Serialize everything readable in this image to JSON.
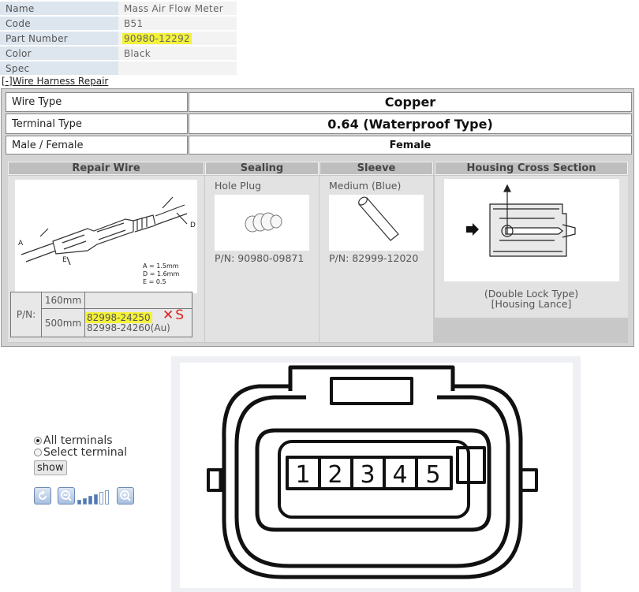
{
  "info": [
    {
      "key": "Name",
      "value": "Mass Air Flow Meter"
    },
    {
      "key": "Code",
      "value": "B51"
    },
    {
      "key": "Part Number",
      "value": "90980-12292"
    },
    {
      "key": "Color",
      "value": "Black"
    },
    {
      "key": "Spec",
      "value": ""
    }
  ],
  "harness": {
    "toggle_prefix": "[-]",
    "toggle_label": "Wire Harness Repair",
    "rows": [
      {
        "key": "Wire Type",
        "value": "Copper"
      },
      {
        "key": "Terminal Type",
        "value": "0.64 (Waterproof Type)"
      },
      {
        "key": "Male / Female",
        "value": "Female"
      }
    ],
    "columns": {
      "repair_wire": {
        "title": "Repair Wire",
        "dims": [
          "A = 1.5mm",
          "D = 1.6mm",
          "E = 0.5"
        ],
        "dim_letters": [
          "A",
          "D",
          "E"
        ],
        "pn_label": "P/N:",
        "lengths": [
          {
            "length": "160mm",
            "pn": "",
            "pn2": ""
          },
          {
            "length": "500mm",
            "pn": "82998-24250",
            "pn2": "82998-24260(Au)"
          }
        ],
        "handwritten": "✕S"
      },
      "sealing": {
        "title": "Sealing",
        "label": "Hole Plug",
        "pn": "P/N: 90980-09871"
      },
      "sleeve": {
        "title": "Sleeve",
        "label": "Medium (Blue)",
        "pn": "P/N: 82999-12020"
      },
      "housing": {
        "title": "Housing Cross Section",
        "caption1": "(Double Lock Type)",
        "caption2": "[Housing Lance]"
      }
    }
  },
  "controls": {
    "options": [
      {
        "label": "All terminals",
        "checked": true
      },
      {
        "label": "Select terminal",
        "checked": false
      }
    ],
    "show_label": "show",
    "zoom_levels": 6,
    "zoom_level": 4
  },
  "connector": {
    "pins": [
      "1",
      "2",
      "3",
      "4",
      "5"
    ]
  },
  "colors": {
    "highlight": "#f4f23a",
    "header_key_bg": "#dde5ee",
    "ink_red": "#e02020"
  }
}
